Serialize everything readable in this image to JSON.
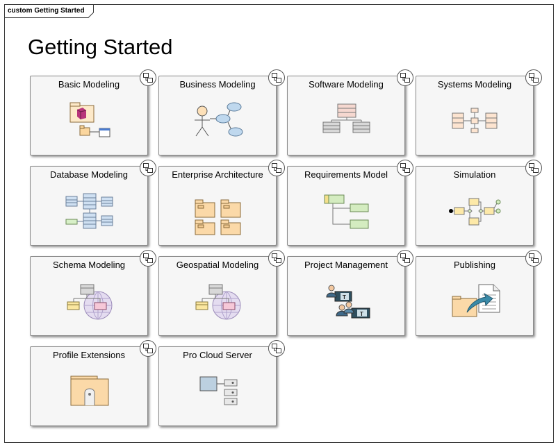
{
  "diagram": {
    "frame_label": "custom Getting Started",
    "title": "Getting Started",
    "cards": [
      {
        "label": "Basic Modeling",
        "icon": "basic-modeling-icon"
      },
      {
        "label": "Business Modeling",
        "icon": "business-modeling-icon"
      },
      {
        "label": "Software Modeling",
        "icon": "software-modeling-icon"
      },
      {
        "label": "Systems Modeling",
        "icon": "systems-modeling-icon"
      },
      {
        "label": "Database Modeling",
        "icon": "database-modeling-icon"
      },
      {
        "label": "Enterprise Architecture",
        "icon": "enterprise-architecture-icon"
      },
      {
        "label": "Requirements Model",
        "icon": "requirements-model-icon"
      },
      {
        "label": "Simulation",
        "icon": "simulation-icon"
      },
      {
        "label": "Schema Modeling",
        "icon": "schema-modeling-icon"
      },
      {
        "label": "Geospatial Modeling",
        "icon": "geospatial-modeling-icon"
      },
      {
        "label": "Project Management",
        "icon": "project-management-icon"
      },
      {
        "label": "Publishing",
        "icon": "publishing-icon"
      },
      {
        "label": "Profile Extensions",
        "icon": "profile-extensions-icon"
      },
      {
        "label": "Pro Cloud Server",
        "icon": "pro-cloud-server-icon"
      }
    ]
  }
}
